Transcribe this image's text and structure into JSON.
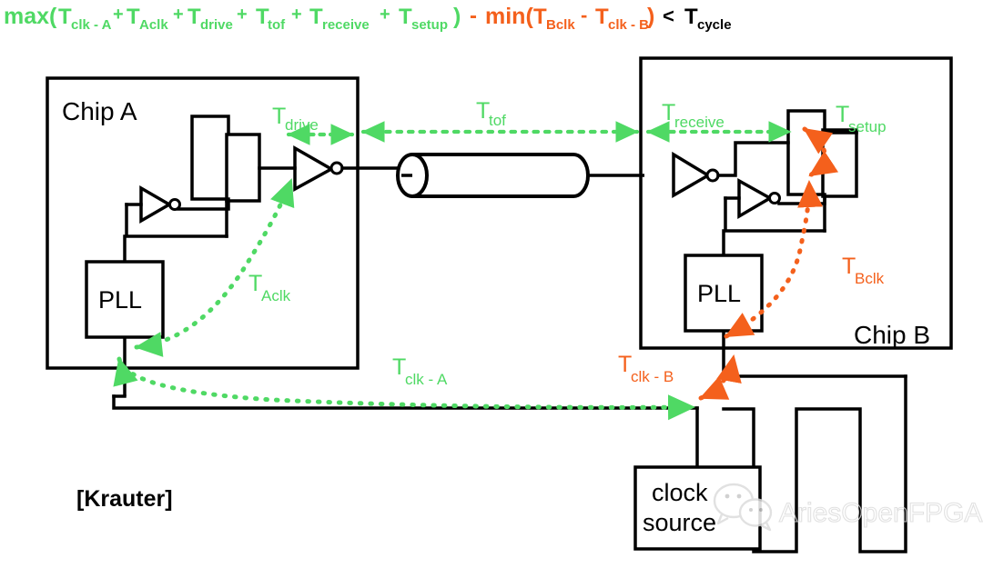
{
  "figure": {
    "title_formula": {
      "green_part_1": "max(",
      "terms_green": [
        {
          "base": "T",
          "sub": "clk - A"
        },
        {
          "base": "T",
          "sub": "Aclk"
        },
        {
          "base": "T",
          "sub": "drive"
        },
        {
          "base": "T",
          "sub": "tof"
        },
        {
          "base": "T",
          "sub": "receive"
        },
        {
          "base": "T",
          "sub": "setup"
        }
      ],
      "green_close": ")",
      "minus": "-",
      "orange_open": "min(",
      "terms_orange": [
        {
          "base": "T",
          "sub": "Bclk"
        },
        {
          "base": "T",
          "sub": "clk - B"
        }
      ],
      "orange_close": ")",
      "less_than": "<",
      "term_black": {
        "base": "T",
        "sub": "cycle"
      },
      "full_text": "max(T_clk-A + T_Aclk + T_drive + T_tof + T_receive + T_setup ) - min(T_Bclk - T_clk-B) < T_cycle"
    },
    "attribution": "[Krauter]",
    "watermark": "AriesOpenFPGA"
  },
  "colors": {
    "green": "#4FD964",
    "orange": "#F4601C",
    "black": "#000000",
    "watermark_gray": "#D8D8D8",
    "white": "#FFFFFF"
  },
  "chips": {
    "chip_a": {
      "label": "Chip A",
      "pll_label": "PLL"
    },
    "chip_b": {
      "label": "Chip B",
      "pll_label": "PLL"
    }
  },
  "clock_source": {
    "line1": "clock",
    "line2": "source"
  },
  "timing_labels": {
    "t_drive": {
      "base": "T",
      "sub": "drive",
      "color": "green"
    },
    "t_aclk": {
      "base": "T",
      "sub": "Aclk",
      "color": "green"
    },
    "t_tof": {
      "base": "T",
      "sub": "tof",
      "color": "green"
    },
    "t_receive": {
      "base": "T",
      "sub": "receive",
      "color": "green"
    },
    "t_setup": {
      "base": "T",
      "sub": "setup",
      "color": "green"
    },
    "t_bclk": {
      "base": "T",
      "sub": "Bclk",
      "color": "orange"
    },
    "t_clk_a": {
      "base": "T",
      "sub": "clk - A",
      "color": "green"
    },
    "t_clk_b": {
      "base": "T",
      "sub": "clk - B",
      "color": "orange"
    }
  }
}
